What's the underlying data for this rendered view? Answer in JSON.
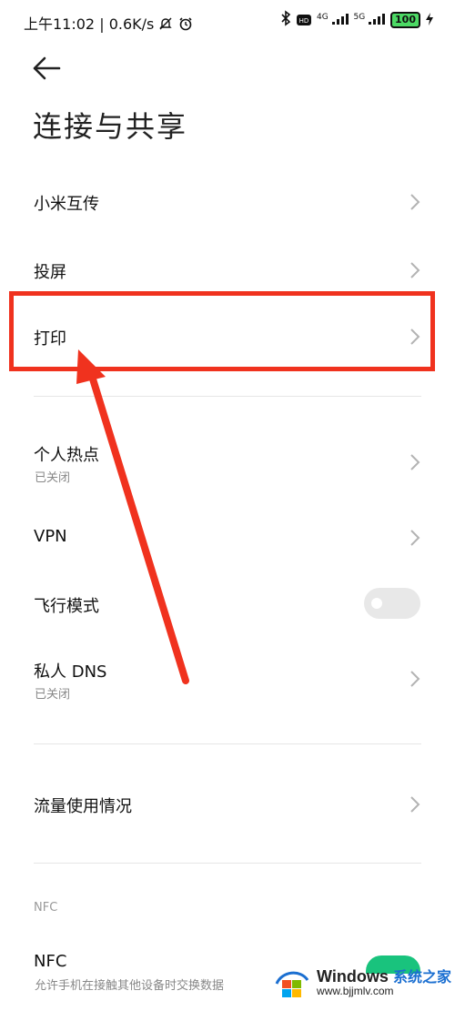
{
  "status_bar": {
    "time": "上午11:02",
    "speed": "0.6K/s",
    "net1": "4G",
    "net2": "5G",
    "battery": "100"
  },
  "header": {
    "title": "连接与共享"
  },
  "items": [
    {
      "label": "小米互传"
    },
    {
      "label": "投屏"
    },
    {
      "label": "打印"
    },
    {
      "label": "个人热点",
      "sub": "已关闭"
    },
    {
      "label": "VPN"
    },
    {
      "label": "飞行模式",
      "toggle": "off"
    },
    {
      "label": "私人 DNS",
      "sub": "已关闭"
    },
    {
      "label": "流量使用情况"
    }
  ],
  "nfc_section": {
    "header": "NFC",
    "label": "NFC",
    "sub": "允许手机在接触其他设备时交换数据",
    "toggle": "on"
  },
  "watermark": {
    "brand": "Windows",
    "brand_cn": "系统之家",
    "url": "www.bjjmlv.com"
  },
  "colors": {
    "highlight": "#f0321e",
    "toggle_on": "#19c37d"
  }
}
